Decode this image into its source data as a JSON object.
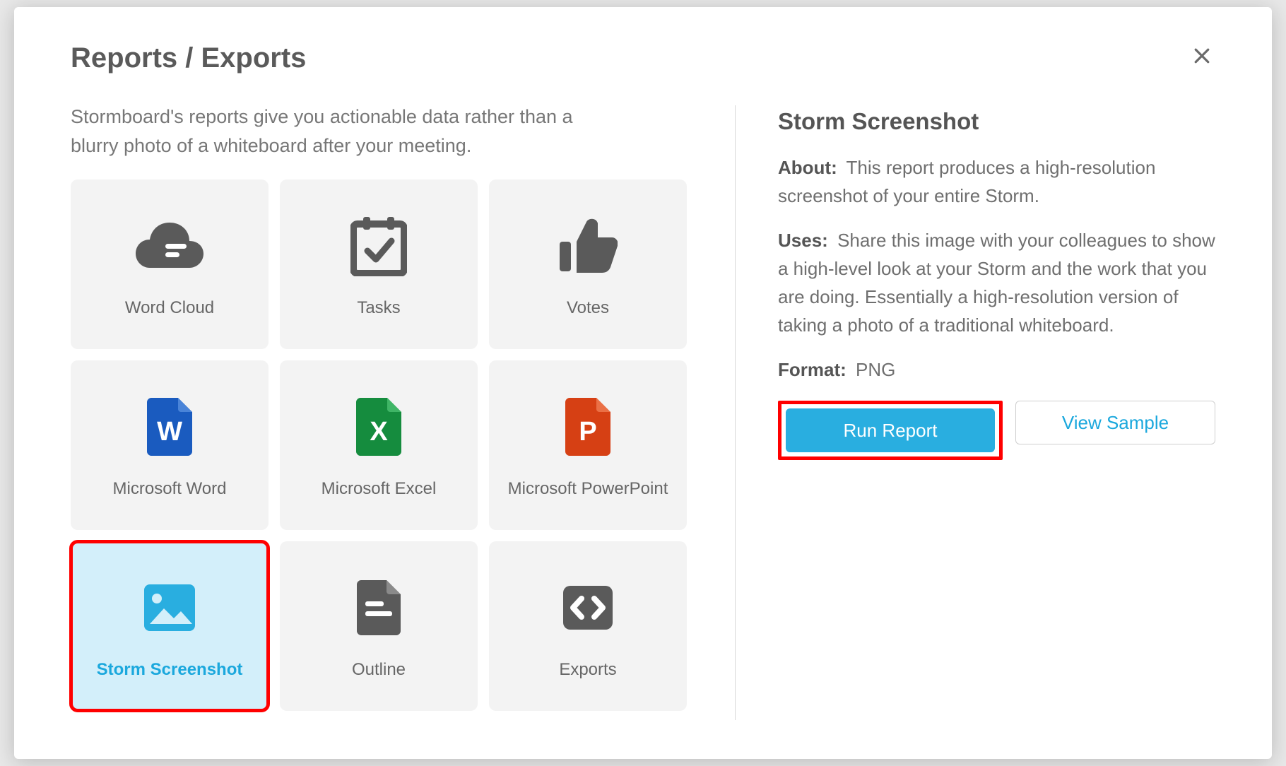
{
  "modal": {
    "title": "Reports / Exports",
    "intro": "Stormboard's reports give you actionable data rather than a blurry photo of a whiteboard after your meeting."
  },
  "tiles": [
    {
      "label": "Word Cloud",
      "icon": "cloud"
    },
    {
      "label": "Tasks",
      "icon": "calendar-check"
    },
    {
      "label": "Votes",
      "icon": "thumbs-up"
    },
    {
      "label": "Microsoft Word",
      "icon": "word"
    },
    {
      "label": "Microsoft Excel",
      "icon": "excel"
    },
    {
      "label": "Microsoft PowerPoint",
      "icon": "powerpoint"
    },
    {
      "label": "Storm Screenshot",
      "icon": "image",
      "selected": true,
      "highlighted": true
    },
    {
      "label": "Outline",
      "icon": "document"
    },
    {
      "label": "Exports",
      "icon": "code"
    }
  ],
  "detail": {
    "title": "Storm Screenshot",
    "about_label": "About:",
    "about_text": "This report produces a high-resolution screenshot of your entire Storm.",
    "uses_label": "Uses:",
    "uses_text": "Share this image with your colleagues to show a high-level look at your Storm and the work that you are doing. Essentially a high-resolution version of taking a photo of a traditional whiteboard.",
    "format_label": "Format:",
    "format_value": "PNG",
    "run_label": "Run Report",
    "sample_label": "View Sample"
  }
}
